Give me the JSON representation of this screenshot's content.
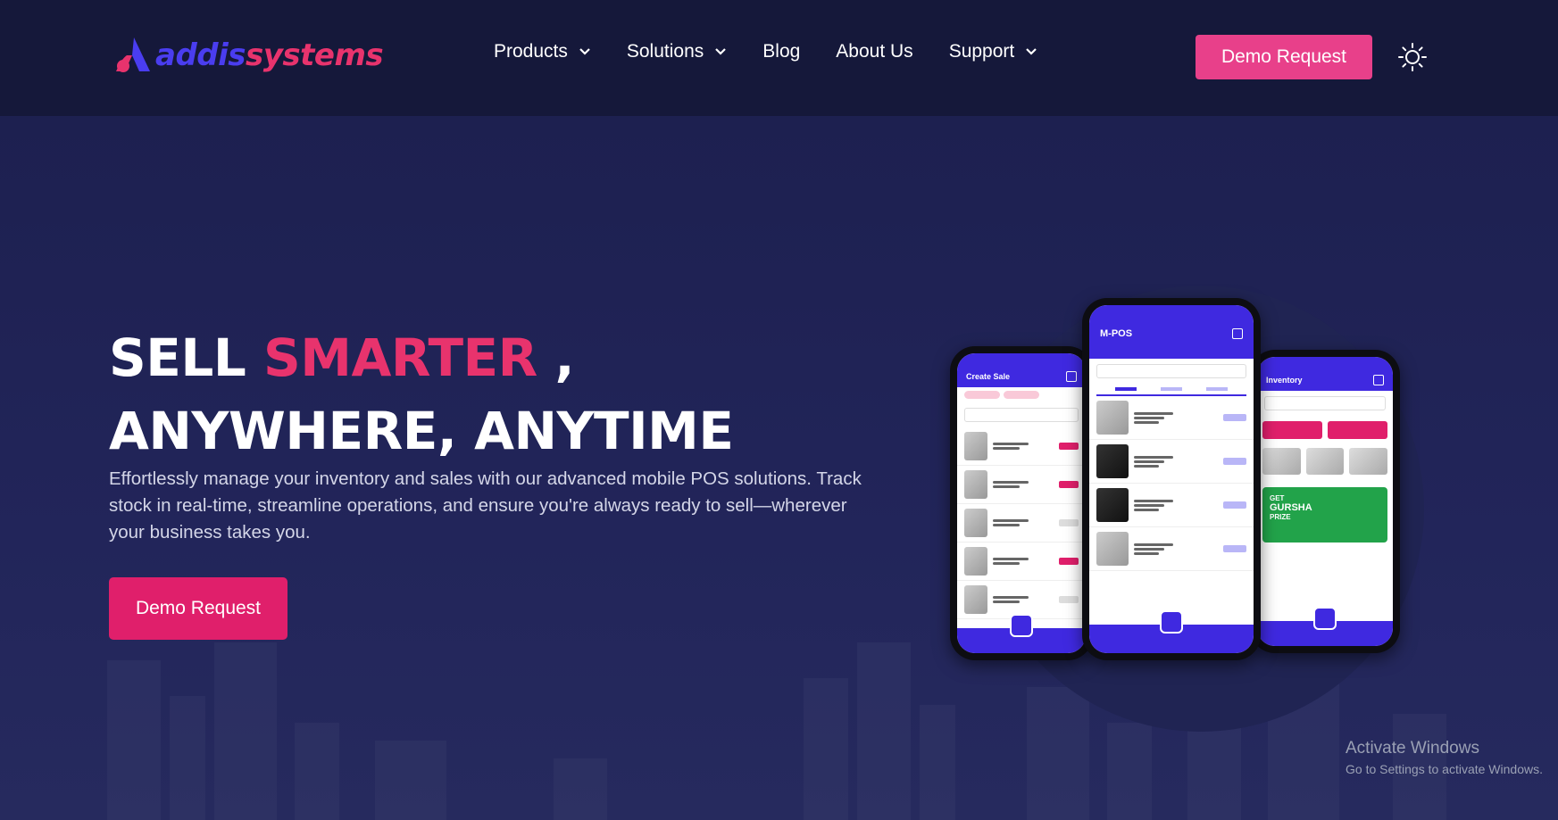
{
  "brand": {
    "logo_part1": "addis",
    "logo_part2": "systems",
    "logo_colors": [
      "#4a3df0",
      "#e8336d"
    ]
  },
  "nav": {
    "items": [
      {
        "label": "Products",
        "has_dropdown": true
      },
      {
        "label": "Solutions",
        "has_dropdown": true
      },
      {
        "label": "Blog",
        "has_dropdown": false
      },
      {
        "label": "About Us",
        "has_dropdown": false
      },
      {
        "label": "Support",
        "has_dropdown": true
      }
    ],
    "demo_label": "Demo Request",
    "theme_icon": "sun-icon"
  },
  "hero": {
    "title_line1_a": "SELL ",
    "title_line1_b": "SMARTER",
    "title_line1_c": " ,",
    "title_line2": "ANYWHERE, ANYTIME",
    "description": "Effortlessly manage your inventory and sales with our advanced mobile POS solutions. Track stock in real-time, streamline operations, and ensure you're always ready to sell—wherever your business takes you.",
    "cta_label": "Demo Request"
  },
  "phones": {
    "left_title": "Create Sale",
    "center_title": "M-POS",
    "right_title": "Inventory",
    "ad_line1": "GET",
    "ad_line2": "GURSHA",
    "ad_line3": "PRIZE"
  },
  "watermark": {
    "line1": "Activate Windows",
    "line2": "Go to Settings to activate Windows."
  },
  "colors": {
    "background": "#1c1f4a",
    "header": "#15183a",
    "accent_pink": "#e8336d",
    "button_pink": "#e01f6b",
    "app_blue": "#3f29e0"
  }
}
